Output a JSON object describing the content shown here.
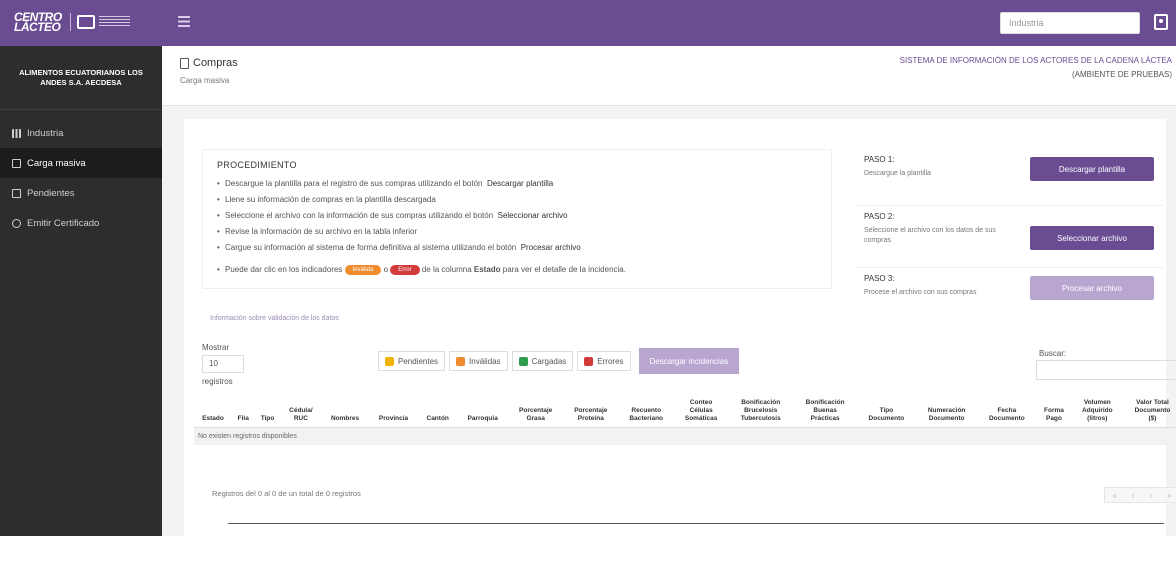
{
  "topbar": {
    "logo_main": "CENTRO\nLÁCTEO",
    "search_placeholder": "Industria"
  },
  "sidebar": {
    "company": "ALIMENTOS ECUATORIANOS LOS ANDES S.A. AECDESA",
    "items": [
      {
        "label": "Industria",
        "icon": "chart-icon"
      },
      {
        "label": "Carga masiva",
        "icon": "file-icon",
        "active": true
      },
      {
        "label": "Pendientes",
        "icon": "bars-icon"
      },
      {
        "label": "Emitir Certificado",
        "icon": "circle-icon"
      }
    ]
  },
  "header": {
    "title": "Compras",
    "subtitle": "Carga masiva",
    "system_title": "SISTEMA DE INFORMACIÓN DE LOS ACTORES DE LA CADENA LÁCTEA",
    "environment": "(AMBIENTE DE PRUEBAS)"
  },
  "procedure": {
    "heading": "PROCEDIMIENTO",
    "items": [
      "Descargue la plantilla para el registro de sus compras utilizando el botón",
      "Llene su información de compras en la plantilla descargada",
      "Seleccione el archivo con la información de sus compras utilizando el botón",
      "Revise la información de su archivo en la tabla inferior",
      "Cargue su información al sistema de forma definitiva al sistema utilizando el botón"
    ],
    "inline": {
      "download": "Descargar plantilla",
      "select": "Seleccionar archivo",
      "process": "Procesar archivo"
    },
    "note_prefix": "Puede dar clic en los indicadores",
    "note_mid": "o",
    "note_suffix": "de la columna",
    "note_bold": "Estado",
    "note_end": "para ver el detalle de la incidencia.",
    "badge_invalid": "Inválida",
    "badge_error": "Error"
  },
  "steps": [
    {
      "title": "PASO 1:",
      "desc": "Descargue la plantilla",
      "button": "Descargar plantilla",
      "disabled": false
    },
    {
      "title": "PASO 2:",
      "desc": "Seleccione el archivo con los datos de sus compras",
      "button": "Seleccionar archivo",
      "disabled": false
    },
    {
      "title": "PASO 3:",
      "desc": "Procese el archivo con sus compras",
      "button": "Procesar archivo",
      "disabled": true
    }
  ],
  "info_link": "Información sobre validación de los datos",
  "table_controls": {
    "show_label": "Mostrar",
    "show_value": "10",
    "show_suffix": "registros",
    "search_label": "Buscar:",
    "filters": [
      {
        "label": "Pendientes",
        "color": "#f0b400"
      },
      {
        "label": "Inválidas",
        "color": "#f08c2e"
      },
      {
        "label": "Cargadas",
        "color": "#2e9e4e"
      },
      {
        "label": "Errores",
        "color": "#d33a3a"
      }
    ],
    "incidents_button": "Descargar incidencias"
  },
  "table": {
    "columns": [
      "Estado",
      "Fila",
      "Tipo",
      "Cédula/\nRUC",
      "Nombres",
      "Provincia",
      "Cantón",
      "Parroquia",
      "Porcentaje\nGrasa",
      "Porcentaje\nProteína",
      "Recuento\nBacteriano",
      "Conteo\nCélulas\nSomáticas",
      "Bonificación\nBrucelosis\nTuberculosis",
      "Bonificación\nBuenas\nPrácticas",
      "Tipo\nDocumento",
      "Numeración\nDocumento",
      "Fecha\nDocumento",
      "Forma\nPago",
      "Volumen\nAdquirido\n(litros)",
      "Valor Total\nDocumento\n($)"
    ],
    "empty": "No existen registros disponibles"
  },
  "footer_info": "Registros del 0 al 0 de un total de 0 registros"
}
